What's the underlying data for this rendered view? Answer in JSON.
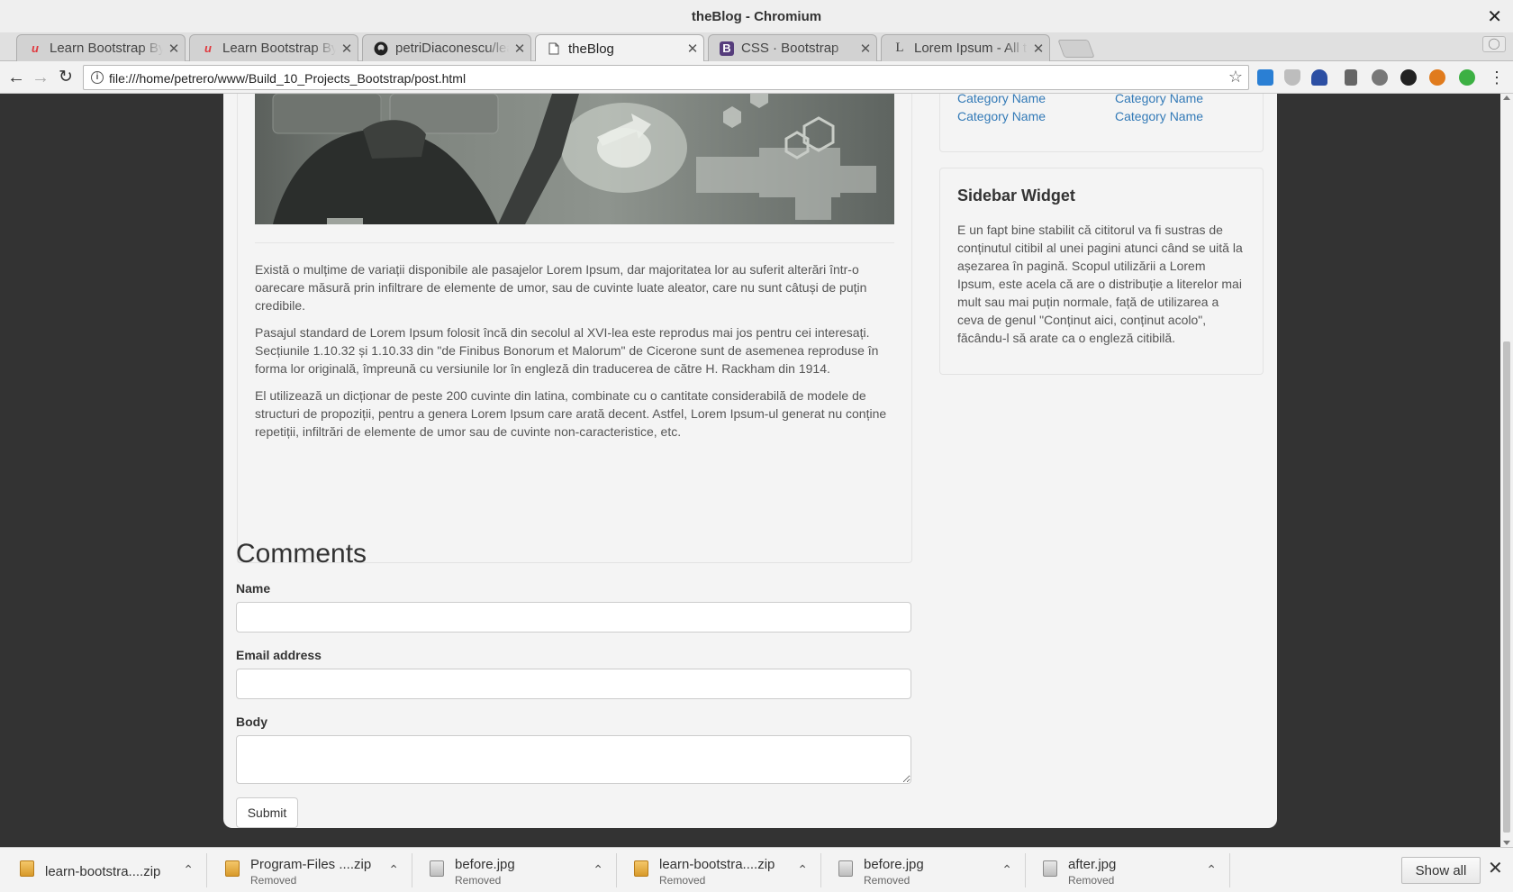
{
  "window": {
    "title": "theBlog - Chromium"
  },
  "tabs": [
    {
      "title": "Learn Bootstrap By",
      "icon": "udemy-icon"
    },
    {
      "title": "Learn Bootstrap By",
      "icon": "udemy-icon"
    },
    {
      "title": "petriDiaconescu/lea",
      "icon": "github-icon"
    },
    {
      "title": "theBlog",
      "icon": "page-icon",
      "active": true
    },
    {
      "title": "CSS · Bootstrap",
      "icon": "bootstrap-icon"
    },
    {
      "title": "Lorem Ipsum - All th",
      "icon": "lipsum-icon"
    }
  ],
  "toolbar": {
    "url": "file:///home/petrero/www/Build_10_Projects_Bootstrap/post.html"
  },
  "sidebar": {
    "categories": {
      "left": [
        "Category Name",
        "Category Name"
      ],
      "right": [
        "Category Name",
        "Category Name"
      ]
    },
    "widget": {
      "title": "Sidebar Widget",
      "text": "E un fapt bine stabilit că cititorul va fi sustras de conținutul citibil al unei pagini atunci când se uită la așezarea în pagină. Scopul utilizării a Lorem Ipsum, este acela că are o distribuție a literelor mai mult sau mai puțin normale, față de utilizarea a ceva de genul \"Conținut aici, conținut acolo\", făcându-l să arate ca o engleză citibilă."
    }
  },
  "post": {
    "paragraphs": [
      "Există o mulțime de variații disponibile ale pasajelor Lorem Ipsum, dar majoritatea lor au suferit alterări într-o oarecare măsură prin infiltrare de elemente de umor, sau de cuvinte luate aleator, care nu sunt câtuși de puțin credibile.",
      "Pasajul standard de Lorem Ipsum folosit încă din secolul al XVI-lea este reprodus mai jos pentru cei interesați. Secțiunile 1.10.32 și 1.10.33 din \"de Finibus Bonorum et Malorum\" de Cicerone sunt de asemenea reproduse în forma lor originală, împreună cu versiunile lor în engleză din traducerea de către H. Rackham din 1914.",
      "El utilizează un dicționar de peste 200 cuvinte din latina, combinate cu o cantitate considerabilă de modele de structuri de propoziții, pentru a genera Lorem Ipsum care arată decent. Astfel, Lorem Ipsum-ul generat nu conține repetiții, infiltrări de elemente de umor sau de cuvinte non-caracteristice, etc."
    ]
  },
  "comments": {
    "title": "Comments",
    "name_label": "Name",
    "email_label": "Email address",
    "body_label": "Body",
    "submit_label": "Submit"
  },
  "downloads": [
    {
      "name": "learn-bootstra....zip",
      "status": "",
      "type": "zip"
    },
    {
      "name": "Program-Files ....zip",
      "status": "Removed",
      "type": "zip"
    },
    {
      "name": "before.jpg",
      "status": "Removed",
      "type": "jpg"
    },
    {
      "name": "learn-bootstra....zip",
      "status": "Removed",
      "type": "zip"
    },
    {
      "name": "before.jpg",
      "status": "Removed",
      "type": "jpg"
    },
    {
      "name": "after.jpg",
      "status": "Removed",
      "type": "jpg"
    }
  ],
  "shelf": {
    "show_all_label": "Show all"
  },
  "colors": {
    "link": "#337ab7",
    "page_bg": "#f4f4f4",
    "outer_bg": "#333333"
  }
}
